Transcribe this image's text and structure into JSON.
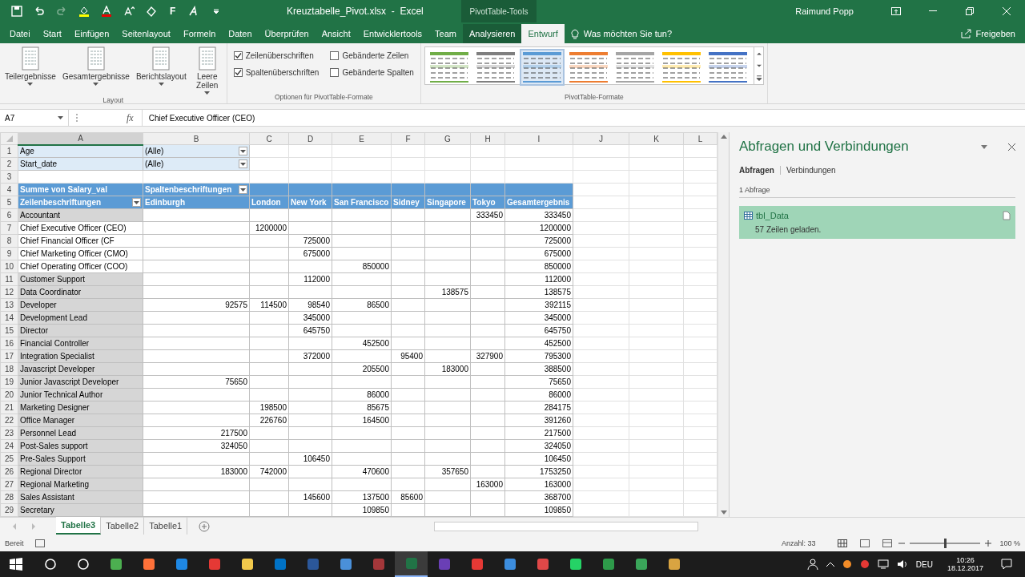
{
  "title_bar": {
    "bold_button": "F",
    "title": "Kreuztabelle_Pivot.xlsx  -  Excel",
    "context_title": "PivotTable-Tools",
    "user": "Raimund Popp"
  },
  "menu_tabs": [
    {
      "label": "Datei",
      "selected": false
    },
    {
      "label": "Start",
      "selected": false
    },
    {
      "label": "Einfügen",
      "selected": false
    },
    {
      "label": "Seitenlayout",
      "selected": false
    },
    {
      "label": "Formeln",
      "selected": false
    },
    {
      "label": "Daten",
      "selected": false
    },
    {
      "label": "Überprüfen",
      "selected": false
    },
    {
      "label": "Ansicht",
      "selected": false
    },
    {
      "label": "Entwicklertools",
      "selected": false
    },
    {
      "label": "Team",
      "selected": false
    },
    {
      "label": "Analysieren",
      "selected": false
    },
    {
      "label": "Entwurf",
      "selected": true
    }
  ],
  "tell_me": {
    "placeholder": "Was möchten Sie tun?"
  },
  "share": "Freigeben",
  "ribbon": {
    "layout": {
      "buttons": [
        "Teilergebnisse",
        "Gesamtergebnisse",
        "Berichtslayout",
        "Leere Zeilen"
      ],
      "label": "Layout"
    },
    "options": {
      "checkboxes": [
        {
          "label": "Zeilenüberschriften",
          "checked": true
        },
        {
          "label": "Gebänderte Zeilen",
          "checked": false
        },
        {
          "label": "Spaltenüberschriften",
          "checked": true
        },
        {
          "label": "Gebänderte Spalten",
          "checked": false
        }
      ],
      "label": "Optionen für PivotTable-Formate"
    },
    "styles": {
      "items": [
        {
          "color": "#70ad47",
          "selected": false
        },
        {
          "color": "#7f7f7f",
          "selected": false
        },
        {
          "color": "#5b9bd5",
          "selected": true
        },
        {
          "color": "#ed7d31",
          "selected": false
        },
        {
          "color": "#a5a5a5",
          "selected": false
        },
        {
          "color": "#ffc000",
          "selected": false
        },
        {
          "color": "#4472c4",
          "selected": false
        }
      ],
      "label": "PivotTable-Formate"
    }
  },
  "formula_bar": {
    "name_box": "A7",
    "fx": "fx",
    "value": "Chief Executive Officer (CEO)"
  },
  "columns": [
    {
      "label": "A",
      "selected": true
    },
    {
      "label": "B",
      "selected": false
    },
    {
      "label": "C",
      "selected": false
    },
    {
      "label": "D",
      "selected": false
    },
    {
      "label": "E",
      "selected": false
    },
    {
      "label": "F",
      "selected": false
    },
    {
      "label": "G",
      "selected": false
    },
    {
      "label": "H",
      "selected": false
    },
    {
      "label": "I",
      "selected": false
    },
    {
      "label": "J",
      "selected": false
    },
    {
      "label": "K",
      "selected": false
    },
    {
      "label": "L",
      "selected": false
    }
  ],
  "row_numbers": [
    "1",
    "2",
    "3",
    "4",
    "5",
    "6",
    "7",
    "8",
    "9",
    "10",
    "11",
    "12",
    "13",
    "14",
    "15",
    "16",
    "17",
    "18",
    "19",
    "20",
    "21",
    "22",
    "23",
    "24",
    "25",
    "26",
    "27",
    "28",
    "29"
  ],
  "pivot": {
    "filters": [
      {
        "label": "Age",
        "value": "(Alle)"
      },
      {
        "label": "Start_date",
        "value": "(Alle)"
      }
    ],
    "value_field": "Summe von Salary_val",
    "column_label": "Spaltenbeschriftungen",
    "row_label": "Zeilenbeschriftungen",
    "column_items": [
      "Edinburgh",
      "London",
      "New York",
      "San Francisco",
      "Sidney",
      "Singapore",
      "Tokyo",
      "Gesamtergebnis"
    ],
    "rows": [
      {
        "label": "Accountant",
        "selected": true,
        "cells": {
          "h": "333450",
          "i": "333450"
        }
      },
      {
        "label": "Chief Executive Officer (CEO)",
        "selected": false,
        "cells": {
          "c": "1200000",
          "i": "1200000"
        }
      },
      {
        "label": "Chief Financial Officer (CF",
        "selected": false,
        "cells": {
          "d": "725000",
          "i": "725000"
        }
      },
      {
        "label": "Chief Marketing Officer (CMO)",
        "selected": false,
        "cells": {
          "d": "675000",
          "i": "675000"
        }
      },
      {
        "label": "Chief Operating Officer (COO)",
        "selected": false,
        "cells": {
          "e": "850000",
          "i": "850000"
        }
      },
      {
        "label": "Customer Support",
        "selected": true,
        "cells": {
          "d": "112000",
          "i": "112000"
        }
      },
      {
        "label": "Data Coordinator",
        "selected": true,
        "cells": {
          "g": "138575",
          "i": "138575"
        }
      },
      {
        "label": "Developer",
        "selected": true,
        "cells": {
          "b": "92575",
          "c": "114500",
          "d": "98540",
          "e": "86500",
          "i": "392115"
        }
      },
      {
        "label": "Development Lead",
        "selected": true,
        "cells": {
          "d": "345000",
          "i": "345000"
        }
      },
      {
        "label": "Director",
        "selected": true,
        "cells": {
          "d": "645750",
          "i": "645750"
        }
      },
      {
        "label": "Financial Controller",
        "selected": true,
        "cells": {
          "e": "452500",
          "i": "452500"
        }
      },
      {
        "label": "Integration Specialist",
        "selected": true,
        "cells": {
          "d": "372000",
          "f": "95400",
          "h": "327900",
          "i": "795300"
        }
      },
      {
        "label": "Javascript Developer",
        "selected": true,
        "cells": {
          "e": "205500",
          "g": "183000",
          "i": "388500"
        }
      },
      {
        "label": "Junior Javascript Developer",
        "selected": true,
        "cells": {
          "b": "75650",
          "i": "75650"
        }
      },
      {
        "label": "Junior Technical Author",
        "selected": true,
        "cells": {
          "e": "86000",
          "i": "86000"
        }
      },
      {
        "label": "Marketing Designer",
        "selected": true,
        "cells": {
          "c": "198500",
          "e": "85675",
          "i": "284175"
        }
      },
      {
        "label": "Office Manager",
        "selected": true,
        "cells": {
          "c": "226760",
          "e": "164500",
          "i": "391260"
        }
      },
      {
        "label": "Personnel Lead",
        "selected": true,
        "cells": {
          "b": "217500",
          "i": "217500"
        }
      },
      {
        "label": "Post-Sales support",
        "selected": true,
        "cells": {
          "b": "324050",
          "i": "324050"
        }
      },
      {
        "label": "Pre-Sales Support",
        "selected": true,
        "cells": {
          "d": "106450",
          "i": "106450"
        }
      },
      {
        "label": "Regional Director",
        "selected": true,
        "cells": {
          "b": "183000",
          "c": "742000",
          "e": "470600",
          "g": "357650",
          "i": "1753250"
        }
      },
      {
        "label": "Regional Marketing",
        "selected": true,
        "cells": {
          "h": "163000",
          "i": "163000"
        }
      },
      {
        "label": "Sales Assistant",
        "selected": true,
        "cells": {
          "d": "145600",
          "e": "137500",
          "f": "85600",
          "i": "368700"
        }
      },
      {
        "label": "Secretary",
        "selected": true,
        "cells": {
          "e": "109850",
          "i": "109850"
        }
      }
    ]
  },
  "pane": {
    "title": "Abfragen und Verbindungen",
    "tabs": [
      {
        "label": "Abfragen",
        "selected": true
      },
      {
        "label": "Verbindungen",
        "selected": false
      }
    ],
    "count": "1 Abfrage",
    "queries": [
      {
        "name": "tbl_Data",
        "status": "57 Zeilen geladen."
      }
    ]
  },
  "sheet_tabs": [
    {
      "label": "Tabelle3",
      "selected": true
    },
    {
      "label": "Tabelle2",
      "selected": false
    },
    {
      "label": "Tabelle1",
      "selected": false
    }
  ],
  "status_bar": {
    "mode": "Bereit",
    "count": "Anzahl: 33",
    "zoom": "100 %",
    "zoom_level": {
      "level": 0.5
    }
  },
  "taskbar": {
    "language": "DEU",
    "time": "10:26",
    "date": "18.12.2017"
  }
}
